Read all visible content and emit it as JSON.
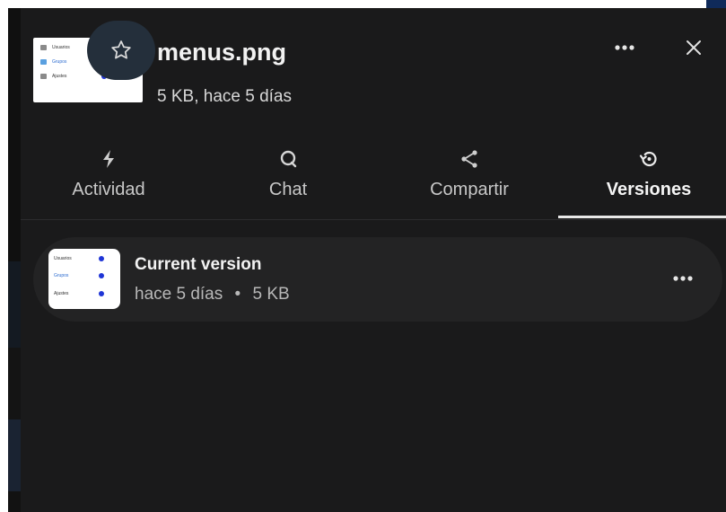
{
  "file": {
    "name": "menus.png",
    "subtitle": "5 KB, hace 5 días",
    "thumbnail_items": [
      {
        "label": "Usuarios"
      },
      {
        "label": "Grupos"
      },
      {
        "label": "Ajustes"
      }
    ]
  },
  "header": {
    "favorite_icon": "star-outline-icon",
    "more_icon": "ellipsis-icon",
    "close_icon": "close-icon"
  },
  "tabs": [
    {
      "label": "Actividad",
      "icon": "lightning-icon",
      "active": false
    },
    {
      "label": "Chat",
      "icon": "chat-bubble-icon",
      "active": false
    },
    {
      "label": "Compartir",
      "icon": "share-icon",
      "active": false
    },
    {
      "label": "Versiones",
      "icon": "history-icon",
      "active": true
    }
  ],
  "versions": [
    {
      "title": "Current version",
      "time": "hace 5 días",
      "separator": "•",
      "size": "5 KB"
    }
  ],
  "colors": {
    "panel_bg": "#1a1a1b",
    "row_bg": "#232324",
    "accent_blue": "#1f35d6",
    "favorite_bg": "#242f3b"
  }
}
